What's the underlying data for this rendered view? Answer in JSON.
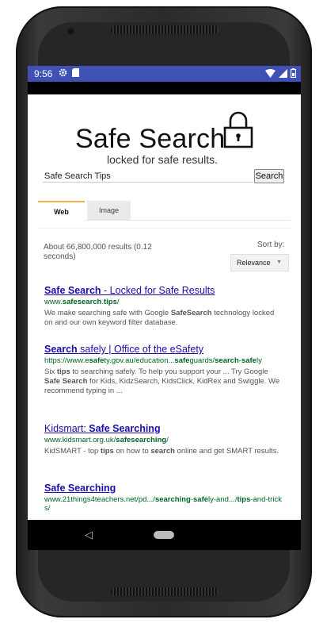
{
  "status_bar": {
    "time": "9:56",
    "left_icons": [
      "gear-icon",
      "sd-card-icon"
    ],
    "right_icons": [
      "wifi-icon",
      "signal-icon",
      "battery-icon"
    ],
    "color": "#3f51b5"
  },
  "header": {
    "title": "Safe Search",
    "subtitle": "locked for safe results.",
    "logo_icon": "padlock-icon"
  },
  "search": {
    "value": "Safe Search Tips",
    "button_label": "Search"
  },
  "tabs": [
    {
      "label": "Web",
      "active": true
    },
    {
      "label": "Image",
      "active": false
    }
  ],
  "results_info": {
    "count_text": "About 66,800,000 results (0.12 seconds)",
    "sort_label": "Sort by:",
    "sort_value": "Relevance"
  },
  "results": [
    {
      "title": "Safe Search - Locked for Safe Results",
      "url": "www.safesearch.tips/",
      "snippet": "We make searching safe with Google SafeSearch technology locked on and our own keyword filter database."
    },
    {
      "title": "Search safely | Office of the eSafety",
      "url": "https://www.esafety.gov.au/education...safeguards/search-safely",
      "snippet": "Six tips to searching safely. To help you support your ... Try Google Safe Search for Kids, KidzSearch, KidsClick, KidRex and Swiggle. We recommend typing in ..."
    },
    {
      "title": "Kidsmart: Safe Searching",
      "url": "www.kidsmart.org.uk/safesearching/",
      "snippet": "KidSMART - top tips on how to search online and get SMART results."
    },
    {
      "title": "Safe Searching",
      "url": "www.21things4teachers.net/pd.../searching-safely-and.../tips-and-tricks/",
      "snippet": ""
    }
  ],
  "nav_bar": {
    "back_icon": "back-triangle-icon",
    "home_icon": "home-pill-icon"
  }
}
